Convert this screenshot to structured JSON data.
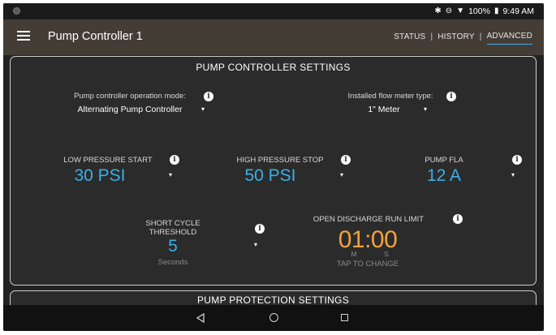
{
  "status_bar": {
    "battery": "100%",
    "time": "9:49 AM",
    "icons": [
      "bluetooth-icon",
      "do-not-disturb-icon",
      "wifi-icon",
      "battery-icon"
    ]
  },
  "app_bar": {
    "title": "Pump Controller 1",
    "tabs": [
      {
        "label": "STATUS",
        "active": false
      },
      {
        "label": "HISTORY",
        "active": false
      },
      {
        "label": "ADVANCED",
        "active": true
      }
    ],
    "accent": "#4aa8e0",
    "background": "#433d36"
  },
  "pump_settings": {
    "title": "PUMP CONTROLLER SETTINGS",
    "operation_mode": {
      "label": "Pump controller operation mode:",
      "value": "Alternating Pump Controller"
    },
    "flow_meter": {
      "label": "Installed flow meter type:",
      "value": "1\" Meter"
    },
    "low_pressure": {
      "label": "LOW PRESSURE START",
      "value": "30 PSI"
    },
    "high_pressure": {
      "label": "HIGH PRESSURE STOP",
      "value": "50 PSI"
    },
    "pump_fla": {
      "label": "PUMP FLA",
      "value": "12 A"
    },
    "short_cycle": {
      "label_line1": "SHORT CYCLE",
      "label_line2": "THRESHOLD",
      "value": "5",
      "unit": "Seconds"
    },
    "discharge": {
      "label": "OPEN DISCHARGE RUN LIMIT",
      "value": "01:00",
      "minutes_unit": "M",
      "seconds_unit": "S",
      "hint": "TAP TO CHANGE"
    },
    "value_color": "#3ab0e8",
    "timer_color": "#f2a23a"
  },
  "protection": {
    "title": "PUMP PROTECTION SETTINGS"
  }
}
